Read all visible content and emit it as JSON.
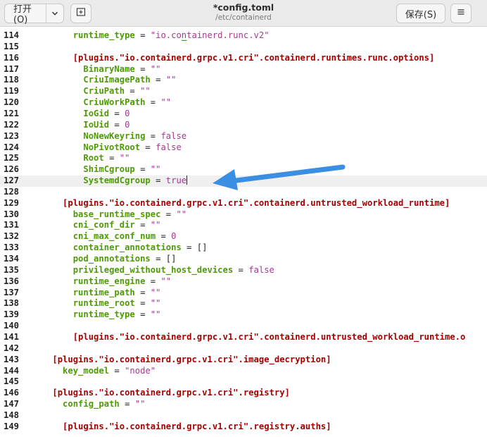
{
  "header": {
    "open_label": "打开(O)",
    "title": "*config.toml",
    "subtitle": "/etc/containerd",
    "save_label": "保存(S)",
    "icons": {
      "open_dropdown": "chevron-down-icon",
      "new_tab": "new-tab-icon",
      "menu": "hamburger-menu-icon"
    }
  },
  "editor": {
    "current_line": "127",
    "colors": {
      "key": "#4e9a06",
      "value": "#a43a8e",
      "section": "#a40000",
      "arrow": "#3b8fe3"
    },
    "lines": [
      {
        "n": "114",
        "segs": [
          {
            "t": "        ",
            "c": ""
          },
          {
            "t": "runtime_type",
            "c": "k"
          },
          {
            "t": " = ",
            "c": "p"
          },
          {
            "t": "\"io.containerd.runc.v2\"",
            "c": "s"
          }
        ]
      },
      {
        "n": "115",
        "segs": []
      },
      {
        "n": "116",
        "segs": [
          {
            "t": "        ",
            "c": ""
          },
          {
            "t": "[plugins.\"io.containerd.grpc.v1.cri\".containerd.runtimes.runc.options]",
            "c": "h"
          }
        ]
      },
      {
        "n": "117",
        "segs": [
          {
            "t": "          ",
            "c": ""
          },
          {
            "t": "BinaryName",
            "c": "k"
          },
          {
            "t": " = ",
            "c": "p"
          },
          {
            "t": "\"\"",
            "c": "s"
          }
        ]
      },
      {
        "n": "118",
        "segs": [
          {
            "t": "          ",
            "c": ""
          },
          {
            "t": "CriuImagePath",
            "c": "k"
          },
          {
            "t": " = ",
            "c": "p"
          },
          {
            "t": "\"\"",
            "c": "s"
          }
        ]
      },
      {
        "n": "119",
        "segs": [
          {
            "t": "          ",
            "c": ""
          },
          {
            "t": "CriuPath",
            "c": "k"
          },
          {
            "t": " = ",
            "c": "p"
          },
          {
            "t": "\"\"",
            "c": "s"
          }
        ]
      },
      {
        "n": "120",
        "segs": [
          {
            "t": "          ",
            "c": ""
          },
          {
            "t": "CriuWorkPath",
            "c": "k"
          },
          {
            "t": " = ",
            "c": "p"
          },
          {
            "t": "\"\"",
            "c": "s"
          }
        ]
      },
      {
        "n": "121",
        "segs": [
          {
            "t": "          ",
            "c": ""
          },
          {
            "t": "IoGid",
            "c": "k"
          },
          {
            "t": " = ",
            "c": "p"
          },
          {
            "t": "0",
            "c": "n"
          }
        ]
      },
      {
        "n": "122",
        "segs": [
          {
            "t": "          ",
            "c": ""
          },
          {
            "t": "IoUid",
            "c": "k"
          },
          {
            "t": " = ",
            "c": "p"
          },
          {
            "t": "0",
            "c": "n"
          }
        ]
      },
      {
        "n": "123",
        "segs": [
          {
            "t": "          ",
            "c": ""
          },
          {
            "t": "NoNewKeyring",
            "c": "k"
          },
          {
            "t": " = ",
            "c": "p"
          },
          {
            "t": "false",
            "c": "n"
          }
        ]
      },
      {
        "n": "124",
        "segs": [
          {
            "t": "          ",
            "c": ""
          },
          {
            "t": "NoPivotRoot",
            "c": "k"
          },
          {
            "t": " = ",
            "c": "p"
          },
          {
            "t": "false",
            "c": "n"
          }
        ]
      },
      {
        "n": "125",
        "segs": [
          {
            "t": "          ",
            "c": ""
          },
          {
            "t": "Root",
            "c": "k"
          },
          {
            "t": " = ",
            "c": "p"
          },
          {
            "t": "\"\"",
            "c": "s"
          }
        ]
      },
      {
        "n": "126",
        "segs": [
          {
            "t": "          ",
            "c": ""
          },
          {
            "t": "ShimCgroup",
            "c": "k"
          },
          {
            "t": " = ",
            "c": "p"
          },
          {
            "t": "\"\"",
            "c": "s"
          }
        ]
      },
      {
        "n": "127",
        "segs": [
          {
            "t": "          ",
            "c": ""
          },
          {
            "t": "SystemdCgroup",
            "c": "k"
          },
          {
            "t": " = ",
            "c": "p"
          },
          {
            "t": "true",
            "c": "n"
          }
        ],
        "cursor": true
      },
      {
        "n": "128",
        "segs": []
      },
      {
        "n": "129",
        "segs": [
          {
            "t": "      ",
            "c": ""
          },
          {
            "t": "[plugins.\"io.containerd.grpc.v1.cri\".containerd.untrusted_workload_runtime]",
            "c": "h"
          }
        ]
      },
      {
        "n": "130",
        "segs": [
          {
            "t": "        ",
            "c": ""
          },
          {
            "t": "base_runtime_spec",
            "c": "k"
          },
          {
            "t": " = ",
            "c": "p"
          },
          {
            "t": "\"\"",
            "c": "s"
          }
        ]
      },
      {
        "n": "131",
        "segs": [
          {
            "t": "        ",
            "c": ""
          },
          {
            "t": "cni_conf_dir",
            "c": "k"
          },
          {
            "t": " = ",
            "c": "p"
          },
          {
            "t": "\"\"",
            "c": "s"
          }
        ]
      },
      {
        "n": "132",
        "segs": [
          {
            "t": "        ",
            "c": ""
          },
          {
            "t": "cni_max_conf_num",
            "c": "k"
          },
          {
            "t": " = ",
            "c": "p"
          },
          {
            "t": "0",
            "c": "n"
          }
        ]
      },
      {
        "n": "133",
        "segs": [
          {
            "t": "        ",
            "c": ""
          },
          {
            "t": "container_annotations",
            "c": "k"
          },
          {
            "t": " = []",
            "c": "p"
          }
        ]
      },
      {
        "n": "134",
        "segs": [
          {
            "t": "        ",
            "c": ""
          },
          {
            "t": "pod_annotations",
            "c": "k"
          },
          {
            "t": " = []",
            "c": "p"
          }
        ]
      },
      {
        "n": "135",
        "segs": [
          {
            "t": "        ",
            "c": ""
          },
          {
            "t": "privileged_without_host_devices",
            "c": "k"
          },
          {
            "t": " = ",
            "c": "p"
          },
          {
            "t": "false",
            "c": "n"
          }
        ]
      },
      {
        "n": "136",
        "segs": [
          {
            "t": "        ",
            "c": ""
          },
          {
            "t": "runtime_engine",
            "c": "k"
          },
          {
            "t": " = ",
            "c": "p"
          },
          {
            "t": "\"\"",
            "c": "s"
          }
        ]
      },
      {
        "n": "137",
        "segs": [
          {
            "t": "        ",
            "c": ""
          },
          {
            "t": "runtime_path",
            "c": "k"
          },
          {
            "t": " = ",
            "c": "p"
          },
          {
            "t": "\"\"",
            "c": "s"
          }
        ]
      },
      {
        "n": "138",
        "segs": [
          {
            "t": "        ",
            "c": ""
          },
          {
            "t": "runtime_root",
            "c": "k"
          },
          {
            "t": " = ",
            "c": "p"
          },
          {
            "t": "\"\"",
            "c": "s"
          }
        ]
      },
      {
        "n": "139",
        "segs": [
          {
            "t": "        ",
            "c": ""
          },
          {
            "t": "runtime_type",
            "c": "k"
          },
          {
            "t": " = ",
            "c": "p"
          },
          {
            "t": "\"\"",
            "c": "s"
          }
        ]
      },
      {
        "n": "140",
        "segs": []
      },
      {
        "n": "141",
        "segs": [
          {
            "t": "        ",
            "c": ""
          },
          {
            "t": "[plugins.\"io.containerd.grpc.v1.cri\".containerd.untrusted_workload_runtime.o",
            "c": "h"
          }
        ]
      },
      {
        "n": "142",
        "segs": []
      },
      {
        "n": "143",
        "segs": [
          {
            "t": "    ",
            "c": ""
          },
          {
            "t": "[plugins.\"io.containerd.grpc.v1.cri\".image_decryption]",
            "c": "h"
          }
        ]
      },
      {
        "n": "144",
        "segs": [
          {
            "t": "      ",
            "c": ""
          },
          {
            "t": "key_model",
            "c": "k"
          },
          {
            "t": " = ",
            "c": "p"
          },
          {
            "t": "\"node\"",
            "c": "s"
          }
        ]
      },
      {
        "n": "145",
        "segs": []
      },
      {
        "n": "146",
        "segs": [
          {
            "t": "    ",
            "c": ""
          },
          {
            "t": "[plugins.\"io.containerd.grpc.v1.cri\".registry]",
            "c": "h"
          }
        ]
      },
      {
        "n": "147",
        "segs": [
          {
            "t": "      ",
            "c": ""
          },
          {
            "t": "config_path",
            "c": "k"
          },
          {
            "t": " = ",
            "c": "p"
          },
          {
            "t": "\"\"",
            "c": "s"
          }
        ]
      },
      {
        "n": "148",
        "segs": []
      },
      {
        "n": "149",
        "segs": [
          {
            "t": "      ",
            "c": ""
          },
          {
            "t": "[plugins.\"io.containerd.grpc.v1.cri\".registry.auths]",
            "c": "h"
          }
        ]
      }
    ]
  }
}
